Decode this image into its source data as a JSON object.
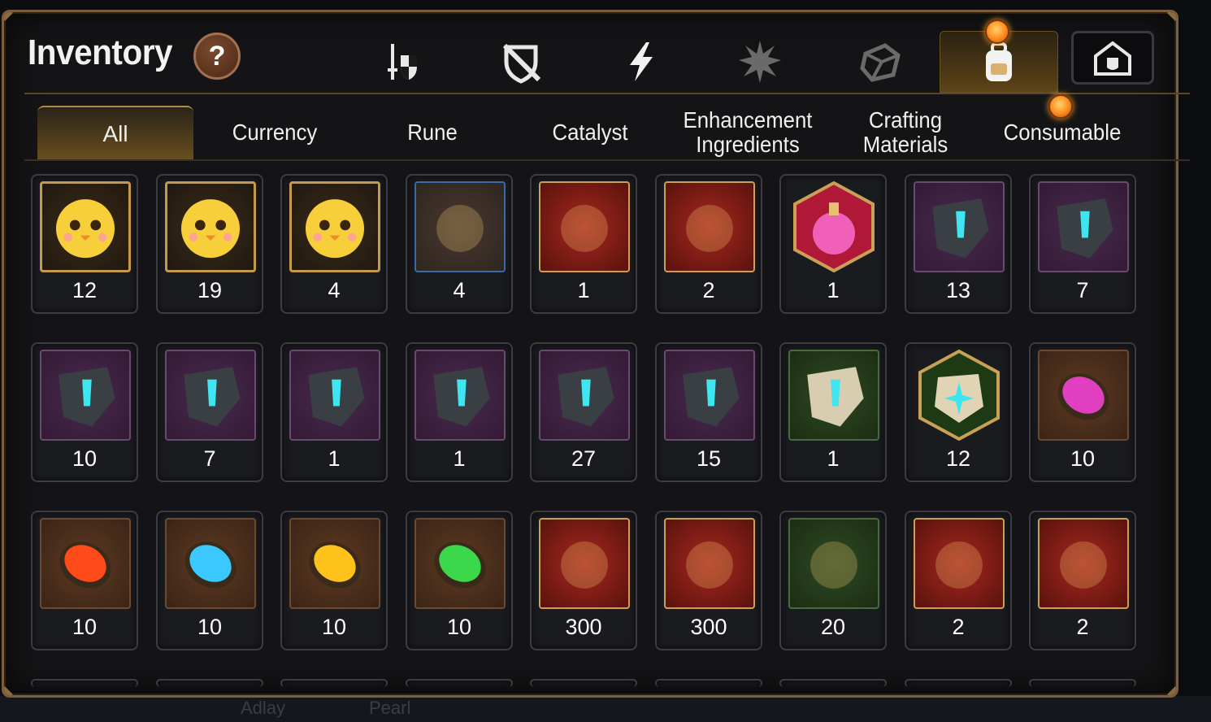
{
  "window": {
    "title": "Inventory",
    "help_label": "?"
  },
  "category_tabs": [
    {
      "icon": "sword-shield-icon",
      "active": false
    },
    {
      "icon": "shield-broken-icon",
      "active": false
    },
    {
      "icon": "lightning-icon",
      "active": false
    },
    {
      "icon": "burst-icon",
      "active": false
    },
    {
      "icon": "cube-icon",
      "active": false
    },
    {
      "icon": "backpack-icon",
      "active": true,
      "notification": true
    }
  ],
  "town_button": {
    "icon": "town-castle-icon"
  },
  "sub_tabs": [
    {
      "label": "All",
      "active": true
    },
    {
      "label": "Currency"
    },
    {
      "label": "Rune"
    },
    {
      "label": "Catalyst"
    },
    {
      "label": "Enhancement Ingredients"
    },
    {
      "label": "Crafting Materials"
    },
    {
      "label": "Consumable",
      "notification": true
    }
  ],
  "items": [
    {
      "icon": "yellow-mascot-red-icon",
      "count": "12",
      "frame": "circle"
    },
    {
      "icon": "yellow-mascot-brown-icon",
      "count": "19",
      "frame": "circle"
    },
    {
      "icon": "yellow-mascot-leaf-icon",
      "count": "4",
      "frame": "circle"
    },
    {
      "icon": "gold-crystals-icon",
      "count": "4",
      "frame": "blue"
    },
    {
      "icon": "red-potion-flask-icon",
      "count": "1",
      "frame": "red"
    },
    {
      "icon": "treasure-chest-icon",
      "count": "2",
      "frame": "red"
    },
    {
      "icon": "pink-potion-icon",
      "count": "1",
      "frame": "hex"
    },
    {
      "icon": "sword-rune-stone-icon",
      "count": "13",
      "frame": "purple"
    },
    {
      "icon": "swirl-rune-stone-icon",
      "count": "7",
      "frame": "purple"
    },
    {
      "icon": "armor-rune-stone-icon",
      "count": "10",
      "frame": "purple"
    },
    {
      "icon": "boot-rune-stone-icon",
      "count": "7",
      "frame": "purple"
    },
    {
      "icon": "ring-rune-stone-icon",
      "count": "1",
      "frame": "purple"
    },
    {
      "icon": "necklace-rune-stone-icon",
      "count": "1",
      "frame": "purple"
    },
    {
      "icon": "hammer-rune-stone-icon",
      "count": "27",
      "frame": "purple"
    },
    {
      "icon": "exclaim-rune-stone-icon",
      "count": "15",
      "frame": "purple"
    },
    {
      "icon": "sword-white-stone-icon",
      "count": "1",
      "frame": "green"
    },
    {
      "icon": "star-white-stone-icon",
      "count": "12",
      "frame": "hex-green"
    },
    {
      "icon": "pink-gem-icon",
      "count": "10",
      "frame": "brown"
    },
    {
      "icon": "red-gem-icon",
      "count": "10",
      "frame": "brown"
    },
    {
      "icon": "blue-gem-icon",
      "count": "10",
      "frame": "brown"
    },
    {
      "icon": "yellow-gem-icon",
      "count": "10",
      "frame": "brown"
    },
    {
      "icon": "green-gem-icon",
      "count": "10",
      "frame": "brown"
    },
    {
      "icon": "rainbow-crystal-icon",
      "count": "300",
      "frame": "red"
    },
    {
      "icon": "blue-claw-icon",
      "count": "300",
      "frame": "red"
    },
    {
      "icon": "grey-claw-icon",
      "count": "20",
      "frame": "green"
    },
    {
      "icon": "red-horn-icon",
      "count": "2",
      "frame": "red"
    },
    {
      "icon": "dark-dust-icon",
      "count": "2",
      "frame": "red"
    }
  ],
  "background_text": [
    "Adlay",
    "Pearl"
  ],
  "colors": {
    "frame_gold": "#c9a055",
    "panel_border": "#7a5f3a",
    "rune_cyan": "#3fe6f0",
    "notification_orange": "#ff8a1e"
  }
}
